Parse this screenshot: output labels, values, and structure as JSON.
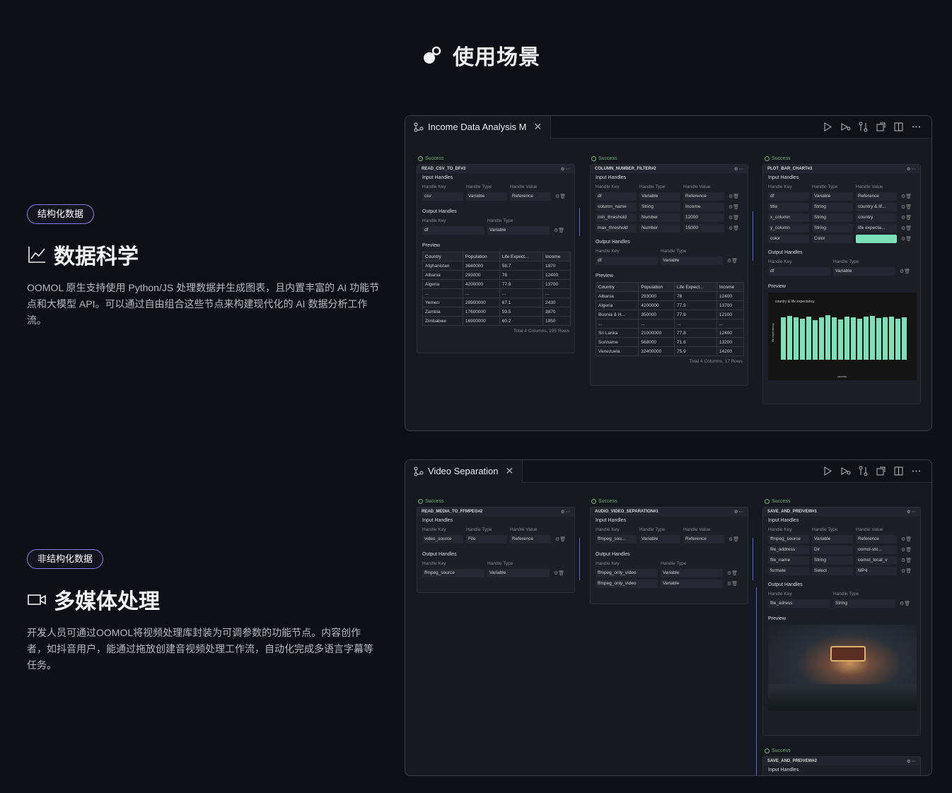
{
  "page": {
    "title": "使用场景"
  },
  "sections": [
    {
      "tag": "结构化数据",
      "heading": "数据科学",
      "desc": "OOMOL 原生支持使用 Python/JS 处理数据并生成图表，且内置丰富的 AI 功能节点和大模型 API。可以通过自由组合这些节点来构建现代化的 AI 数据分析工作流。"
    },
    {
      "tag": "非结构化数据",
      "heading": "多媒体处理",
      "desc": "开发人员可通过OOMOL将视频处理库封装为可调参数的功能节点。内容创作者，如抖音用户，能通过拖放创建音视频处理工作流，自动化完成多语言字幕等任务。"
    }
  ],
  "panel1": {
    "tab": "Income Data Analysis M",
    "labels": {
      "success": "Success",
      "input_handles": "Input Handles",
      "output_handles": "Output Handles",
      "preview": "Preview",
      "handle_key": "Handle Key",
      "handle_type": "Handle Type",
      "handle_value": "Handle Value"
    },
    "n1": {
      "name": "READ_CSV_TO_DF#3",
      "in": [
        [
          "csv",
          "Variable",
          "Reference"
        ]
      ],
      "out": [
        [
          "df",
          "Variable"
        ]
      ],
      "cols": [
        "Country",
        "Population",
        "Life Expect...",
        "Income"
      ],
      "rows": [
        [
          "Afghanistan",
          "3640000",
          "58.7",
          "1870"
        ],
        [
          "Albania",
          "293000",
          "78",
          "12400"
        ],
        [
          "Algeria",
          "4200000",
          "77.9",
          "13700"
        ],
        [
          "...",
          "...",
          "...",
          "..."
        ],
        [
          "Yemen",
          "28900000",
          "67.1",
          "2430"
        ],
        [
          "Zambia",
          "17600000",
          "59.5",
          "3870"
        ],
        [
          "Zimbabwe",
          "16900000",
          "60.2",
          "1950"
        ]
      ],
      "foot": "Total 4 Columns, 195 Rows"
    },
    "n2": {
      "name": "COLUMN_NUMBER_FILTER#2",
      "in": [
        [
          "df",
          "Variable",
          "Reference"
        ],
        [
          "column_name",
          "String",
          "Income"
        ],
        [
          "min_threshold",
          "Number",
          "12000"
        ],
        [
          "max_threshold",
          "Number",
          "15000"
        ]
      ],
      "out": [
        [
          "df",
          "Variable"
        ]
      ],
      "cols": [
        "Country",
        "Population",
        "Life Expect...",
        "Income"
      ],
      "rows": [
        [
          "Albania",
          "293000",
          "78",
          "12400"
        ],
        [
          "Algeria",
          "4200000",
          "77.9",
          "13700"
        ],
        [
          "Bosnia & H...",
          "350000",
          "77.9",
          "12100"
        ],
        [
          "...",
          "...",
          "...",
          "..."
        ],
        [
          "Sri Lanka",
          "21000000",
          "77.8",
          "12400"
        ],
        [
          "Suriname",
          "568000",
          "71.6",
          "13200"
        ],
        [
          "Venezuela",
          "32400000",
          "75.9",
          "14200"
        ]
      ],
      "foot": "Total 4 Columns, 17 Rows"
    },
    "n3": {
      "name": "PLOT_BAR_CHART#3",
      "in": [
        [
          "df",
          "Variable",
          "Reference"
        ],
        [
          "title",
          "String",
          "country & lif..."
        ],
        [
          "x_column",
          "String",
          "country"
        ],
        [
          "y_column",
          "String",
          "life expecta..."
        ],
        [
          "color",
          "Color",
          ""
        ]
      ],
      "out": [
        [
          "df",
          "Variable"
        ]
      ],
      "chart_title": "country & life expectancy",
      "chart_xlabel": "country",
      "chart_ylabel": "life expectancy",
      "accent": "#7ee0b8"
    }
  },
  "panel2": {
    "tab": "Video Separation",
    "n1": {
      "name": "READ_MEDIA_TO_FFMPEG#2",
      "in": [
        [
          "video_source",
          "File",
          "Reference"
        ]
      ],
      "out": [
        [
          "ffmpeg_source",
          "Variable"
        ]
      ]
    },
    "n2": {
      "name": "AUDIO_VIDEO_SEPARATION#1",
      "in": [
        [
          "ffmpeg_sou...",
          "Variable",
          "Reference"
        ]
      ],
      "out": [
        [
          "ffmpeg_only_video",
          "Variable"
        ],
        [
          "ffmpeg_only_video",
          "Variable"
        ]
      ]
    },
    "n3": {
      "name": "SAVE_AND_PREIVEW#1",
      "in": [
        [
          "ffmpeg_source",
          "Variable",
          "Reference"
        ],
        [
          "file_address",
          "Dir",
          "oomol-sto..."
        ],
        [
          "file_name",
          "String",
          "oomol_local_v"
        ],
        [
          "formate",
          "Select",
          "MP4"
        ]
      ],
      "out": [
        [
          "file_adress",
          "String"
        ]
      ]
    },
    "n4": {
      "name": "SAVE_AND_PREIVEW#2",
      "in_label": "Input Handles"
    }
  }
}
